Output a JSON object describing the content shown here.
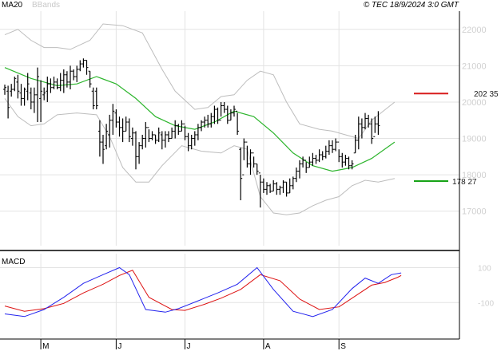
{
  "header": {
    "ma_label": "MA20",
    "bbands_label": "BBands",
    "copyright": "© TEC 18/9/2024 3:0 GMT"
  },
  "colors": {
    "price_bar": "#000000",
    "ma20": "#2db52d",
    "bbands": "#bdbdbd",
    "resistance": "#d81c1c",
    "support": "#17a317",
    "macd_line": "#2222ee",
    "signal_line": "#dd1111",
    "grid": "#e3e3e3"
  },
  "chart_data": [
    {
      "type": "ohlc",
      "name": "price",
      "y_ticks": [
        17000,
        18000,
        19000,
        20000,
        21000,
        22000
      ],
      "y_tick_labels": [
        "17000",
        "18000",
        "19000",
        "20000",
        "21000",
        "22000"
      ],
      "ylim": [
        16050,
        22500
      ],
      "x_months": [
        {
          "label": "M",
          "index": 11
        },
        {
          "label": "J",
          "index": 34
        },
        {
          "label": "J",
          "index": 55
        },
        {
          "label": "A",
          "index": 79
        },
        {
          "label": "S",
          "index": 102
        }
      ],
      "levels": [
        {
          "name": "resistance",
          "value": 20235,
          "label": "202 35"
        },
        {
          "name": "support",
          "value": 17827,
          "label": "178 27"
        }
      ],
      "bars": [
        [
          20480,
          20200,
          20350,
          20400
        ],
        [
          20450,
          19550,
          20300,
          19850
        ],
        [
          20500,
          20150,
          20300,
          20350
        ],
        [
          20700,
          20300,
          20350,
          20650
        ],
        [
          20750,
          20100,
          20550,
          20300
        ],
        [
          20500,
          19900,
          20250,
          20100
        ],
        [
          20400,
          19900,
          20100,
          20350
        ],
        [
          20800,
          20050,
          20300,
          20500
        ],
        [
          20400,
          19800,
          20250,
          20000
        ],
        [
          20400,
          19700,
          20000,
          20200
        ],
        [
          20950,
          19450,
          20200,
          20700
        ],
        [
          20600,
          19450,
          20100,
          20300
        ],
        [
          20400,
          20050,
          20200,
          20250
        ],
        [
          20700,
          20000,
          20300,
          20500
        ],
        [
          20650,
          20250,
          20500,
          20400
        ],
        [
          20700,
          20350,
          20400,
          20550
        ],
        [
          20650,
          20350,
          20550,
          20400
        ],
        [
          20800,
          20300,
          20400,
          20600
        ],
        [
          20900,
          20250,
          20600,
          20750
        ],
        [
          20850,
          20400,
          20750,
          20550
        ],
        [
          21000,
          20350,
          20550,
          20850
        ],
        [
          20900,
          20600,
          20850,
          20700
        ],
        [
          21000,
          20550,
          20700,
          20900
        ],
        [
          21150,
          20850,
          20900,
          21050
        ],
        [
          21200,
          20950,
          21050,
          21150
        ],
        [
          21150,
          20750,
          21150,
          20950
        ],
        [
          20850,
          20400,
          20850,
          20500
        ],
        [
          20400,
          19800,
          20300,
          19900
        ],
        [
          20400,
          19800,
          20300,
          19900
        ],
        [
          19500,
          18500,
          19200,
          18900
        ],
        [
          19100,
          18300,
          18900,
          18700
        ],
        [
          19400,
          18700,
          18800,
          19200
        ],
        [
          19650,
          18750,
          19100,
          19500
        ],
        [
          19950,
          19100,
          19500,
          19750
        ],
        [
          19800,
          19300,
          19700,
          19450
        ],
        [
          19600,
          19050,
          19450,
          19300
        ],
        [
          19550,
          18900,
          19300,
          19200
        ],
        [
          19600,
          19200,
          19200,
          19450
        ],
        [
          19550,
          18900,
          19450,
          19050
        ],
        [
          19300,
          18800,
          19000,
          19150
        ],
        [
          19200,
          18150,
          19150,
          18500
        ],
        [
          18900,
          18300,
          18500,
          18800
        ],
        [
          19100,
          18700,
          18800,
          19000
        ],
        [
          19450,
          18750,
          19000,
          19300
        ],
        [
          19250,
          18900,
          19300,
          19000
        ],
        [
          19200,
          18950,
          19000,
          19100
        ],
        [
          19100,
          18850,
          19100,
          18950
        ],
        [
          19300,
          18900,
          18950,
          19150
        ],
        [
          19200,
          18700,
          19100,
          18950
        ],
        [
          19200,
          18750,
          18950,
          19100
        ],
        [
          19200,
          18900,
          19100,
          19000
        ],
        [
          19300,
          19000,
          19000,
          19200
        ],
        [
          19500,
          19000,
          19200,
          19350
        ],
        [
          19400,
          19100,
          19350,
          19200
        ],
        [
          19500,
          19200,
          19200,
          19400
        ],
        [
          19350,
          18950,
          19400,
          19050
        ],
        [
          19150,
          18650,
          19050,
          18800
        ],
        [
          19100,
          18700,
          18800,
          19000
        ],
        [
          19200,
          18800,
          19000,
          19100
        ],
        [
          19400,
          18950,
          19100,
          19300
        ],
        [
          19500,
          19200,
          19300,
          19450
        ],
        [
          19600,
          19300,
          19450,
          19500
        ],
        [
          19650,
          19300,
          19500,
          19400
        ],
        [
          19700,
          19300,
          19400,
          19600
        ],
        [
          19900,
          19400,
          19600,
          19800
        ],
        [
          19850,
          19400,
          19800,
          19500
        ],
        [
          20000,
          19600,
          19500,
          19900
        ],
        [
          20000,
          19700,
          19900,
          19800
        ],
        [
          19900,
          19400,
          19800,
          19500
        ],
        [
          19800,
          19500,
          19500,
          19700
        ],
        [
          19900,
          19600,
          19700,
          19800
        ],
        [
          19700,
          19100,
          19750,
          19200
        ],
        [
          18750,
          17300,
          18700,
          17900
        ],
        [
          19000,
          18400,
          18000,
          18900
        ],
        [
          18800,
          18200,
          18900,
          18300
        ],
        [
          18700,
          18000,
          18300,
          18600
        ],
        [
          18500,
          18200,
          18600,
          18300
        ],
        [
          18300,
          18000,
          18300,
          18100
        ],
        [
          18000,
          17100,
          18050,
          17800
        ],
        [
          17900,
          17500,
          17800,
          17600
        ],
        [
          17800,
          17450,
          17600,
          17700
        ],
        [
          17750,
          17500,
          17700,
          17550
        ],
        [
          17850,
          17550,
          17550,
          17750
        ],
        [
          17800,
          17450,
          17750,
          17600
        ],
        [
          17700,
          17450,
          17600,
          17650
        ],
        [
          17850,
          17500,
          17650,
          17800
        ],
        [
          17800,
          17400,
          17800,
          17500
        ],
        [
          17900,
          17500,
          17500,
          17700
        ],
        [
          17950,
          17600,
          17700,
          17900
        ],
        [
          18200,
          17800,
          17900,
          18100
        ],
        [
          18400,
          17900,
          18100,
          18300
        ],
        [
          18500,
          18200,
          18300,
          18400
        ],
        [
          18350,
          18050,
          18400,
          18200
        ],
        [
          18500,
          18200,
          18200,
          18350
        ],
        [
          18600,
          18250,
          18350,
          18450
        ],
        [
          18550,
          18300,
          18450,
          18400
        ],
        [
          18700,
          18350,
          18400,
          18550
        ],
        [
          18650,
          18400,
          18550,
          18500
        ],
        [
          18800,
          18450,
          18500,
          18650
        ],
        [
          18950,
          18550,
          18650,
          18800
        ],
        [
          18950,
          18600,
          18800,
          18700
        ],
        [
          19000,
          18650,
          18700,
          18900
        ],
        [
          18700,
          18350,
          18900,
          18500
        ],
        [
          18600,
          18200,
          18500,
          18350
        ],
        [
          18550,
          18250,
          18350,
          18450
        ],
        [
          18500,
          18150,
          18450,
          18250
        ],
        [
          18400,
          18150,
          18250,
          18300
        ],
        [
          19100,
          18600,
          18600,
          18950
        ],
        [
          19600,
          18700,
          18950,
          19400
        ],
        [
          19550,
          19000,
          19400,
          19300
        ],
        [
          19700,
          19250,
          19300,
          19550
        ],
        [
          19650,
          19300,
          19550,
          19400
        ],
        [
          19550,
          18850,
          19400,
          19000
        ],
        [
          19600,
          19150,
          19050,
          19400
        ],
        [
          19750,
          19100,
          19400,
          19350
        ]
      ],
      "ma20": [
        [
          0,
          20950
        ],
        [
          8,
          20650
        ],
        [
          16,
          20450
        ],
        [
          22,
          20500
        ],
        [
          28,
          20700
        ],
        [
          34,
          20500
        ],
        [
          40,
          20100
        ],
        [
          46,
          19600
        ],
        [
          52,
          19350
        ],
        [
          58,
          19250
        ],
        [
          64,
          19450
        ],
        [
          70,
          19750
        ],
        [
          76,
          19600
        ],
        [
          82,
          19150
        ],
        [
          88,
          18600
        ],
        [
          94,
          18250
        ],
        [
          100,
          18100
        ],
        [
          106,
          18200
        ],
        [
          112,
          18450
        ],
        [
          119,
          18900
        ]
      ],
      "bb_upper": [
        [
          0,
          21850
        ],
        [
          4,
          22000
        ],
        [
          8,
          21700
        ],
        [
          12,
          21500
        ],
        [
          16,
          21500
        ],
        [
          20,
          21450
        ],
        [
          26,
          21700
        ],
        [
          30,
          22150
        ],
        [
          36,
          22100
        ],
        [
          42,
          21900
        ],
        [
          48,
          20900
        ],
        [
          52,
          20300
        ],
        [
          58,
          19800
        ],
        [
          62,
          19850
        ],
        [
          66,
          20150
        ],
        [
          70,
          20200
        ],
        [
          74,
          20600
        ],
        [
          78,
          20850
        ],
        [
          82,
          20750
        ],
        [
          86,
          20000
        ],
        [
          90,
          19400
        ],
        [
          96,
          19250
        ],
        [
          100,
          19200
        ],
        [
          104,
          19100
        ],
        [
          108,
          19000
        ],
        [
          112,
          19500
        ],
        [
          119,
          20000
        ]
      ],
      "bb_lower": [
        [
          0,
          20100
        ],
        [
          4,
          19600
        ],
        [
          8,
          19350
        ],
        [
          12,
          19400
        ],
        [
          16,
          19650
        ],
        [
          22,
          19700
        ],
        [
          28,
          19650
        ],
        [
          32,
          19050
        ],
        [
          36,
          18200
        ],
        [
          40,
          17800
        ],
        [
          44,
          17800
        ],
        [
          48,
          18250
        ],
        [
          54,
          18800
        ],
        [
          60,
          18650
        ],
        [
          66,
          18600
        ],
        [
          70,
          18800
        ],
        [
          74,
          18700
        ],
        [
          78,
          17400
        ],
        [
          82,
          16950
        ],
        [
          86,
          16900
        ],
        [
          90,
          16950
        ],
        [
          94,
          17150
        ],
        [
          98,
          17300
        ],
        [
          102,
          17400
        ],
        [
          106,
          17700
        ],
        [
          110,
          17850
        ],
        [
          114,
          17800
        ],
        [
          119,
          17900
        ]
      ]
    },
    {
      "type": "line",
      "name": "MACD",
      "title": "MACD",
      "y_ticks": [
        100,
        -100
      ],
      "y_tick_labels": [
        "100",
        "-100"
      ],
      "ylim": [
        -300,
        180
      ],
      "series": [
        {
          "key": "macd_line",
          "values": [
            [
              0,
              -165
            ],
            [
              6,
              -180
            ],
            [
              12,
              -140
            ],
            [
              18,
              -70
            ],
            [
              24,
              10
            ],
            [
              30,
              60
            ],
            [
              35,
              100
            ],
            [
              38,
              60
            ],
            [
              43,
              -140
            ],
            [
              49,
              -155
            ],
            [
              53,
              -135
            ],
            [
              59,
              -90
            ],
            [
              65,
              -45
            ],
            [
              71,
              5
            ],
            [
              77,
              100
            ],
            [
              82,
              -25
            ],
            [
              88,
              -150
            ],
            [
              94,
              -180
            ],
            [
              100,
              -140
            ],
            [
              106,
              -20
            ],
            [
              110,
              40
            ],
            [
              114,
              10
            ],
            [
              118,
              60
            ],
            [
              121,
              70
            ]
          ]
        },
        {
          "key": "signal_line",
          "values": [
            [
              0,
              -120
            ],
            [
              6,
              -150
            ],
            [
              12,
              -135
            ],
            [
              18,
              -105
            ],
            [
              24,
              -45
            ],
            [
              30,
              5
            ],
            [
              35,
              55
            ],
            [
              39,
              85
            ],
            [
              44,
              -70
            ],
            [
              51,
              -140
            ],
            [
              55,
              -145
            ],
            [
              61,
              -110
            ],
            [
              66,
              -75
            ],
            [
              72,
              -25
            ],
            [
              78,
              60
            ],
            [
              84,
              25
            ],
            [
              90,
              -80
            ],
            [
              96,
              -140
            ],
            [
              102,
              -125
            ],
            [
              108,
              -50
            ],
            [
              112,
              0
            ],
            [
              116,
              15
            ],
            [
              120,
              45
            ],
            [
              121,
              55
            ]
          ]
        }
      ]
    }
  ]
}
